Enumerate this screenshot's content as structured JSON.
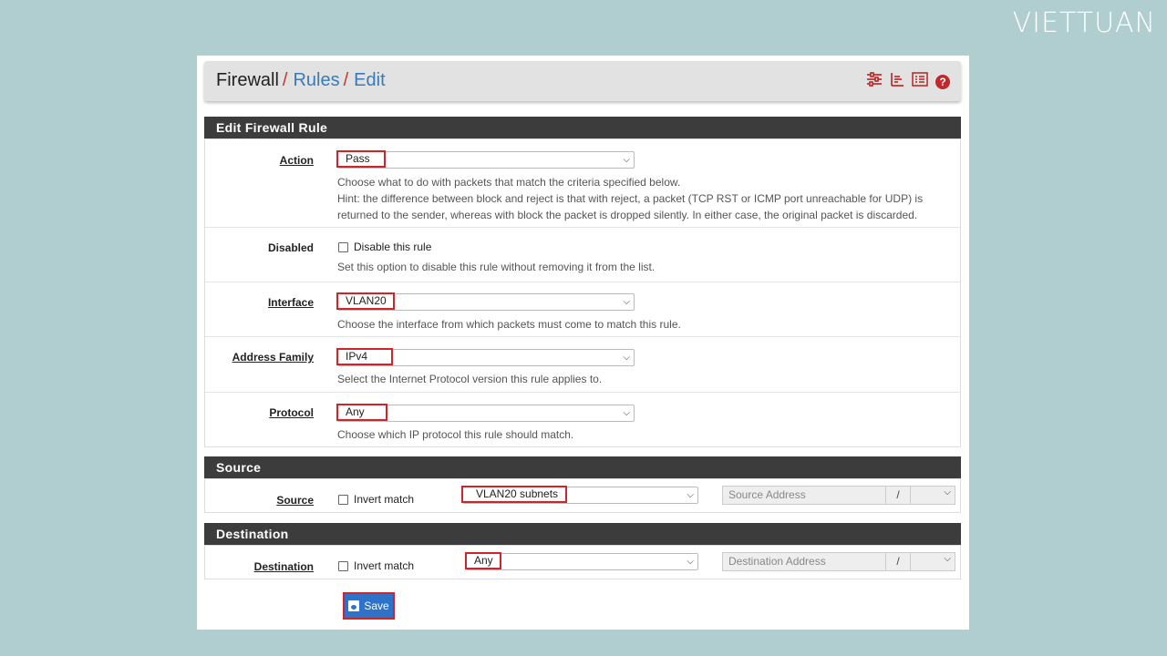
{
  "brand": {
    "logo_text": "VIETTUAN"
  },
  "breadcrumb": {
    "root": "Firewall",
    "sep": "/",
    "rules": "Rules",
    "edit": "Edit"
  },
  "header_icons": [
    "sliders-icon",
    "chart-icon",
    "list-icon",
    "help-icon"
  ],
  "edit_panel": {
    "title": "Edit Firewall Rule",
    "action": {
      "label": "Action",
      "value": "Pass",
      "help1": "Choose what to do with packets that match the criteria specified below.",
      "help2": "Hint: the difference between block and reject is that with reject, a packet (TCP RST or ICMP port unreachable for UDP) is returned to the sender, whereas with block the packet is dropped silently. In either case, the original packet is discarded."
    },
    "disabled": {
      "label": "Disabled",
      "checkbox_label": "Disable this rule",
      "checked": false,
      "help": "Set this option to disable this rule without removing it from the list."
    },
    "interface": {
      "label": "Interface",
      "value": "VLAN20",
      "help": "Choose the interface from which packets must come to match this rule."
    },
    "address_family": {
      "label": "Address Family",
      "value": "IPv4",
      "help": "Select the Internet Protocol version this rule applies to."
    },
    "protocol": {
      "label": "Protocol",
      "value": "Any",
      "help": "Choose which IP protocol this rule should match."
    }
  },
  "source_panel": {
    "title": "Source",
    "label": "Source",
    "invert_label": "Invert match",
    "invert_checked": false,
    "value": "VLAN20 subnets",
    "address_placeholder": "Source Address",
    "slash": "/"
  },
  "destination_panel": {
    "title": "Destination",
    "label": "Destination",
    "invert_label": "Invert match",
    "invert_checked": false,
    "value": "Any",
    "address_placeholder": "Destination Address",
    "slash": "/"
  },
  "save_label": "Save",
  "colors": {
    "header_dark": "#3c3c3c",
    "link": "#3a7ab8",
    "highlight": "#d0232a",
    "save": "#2f73c9",
    "background": "#b0cdcf"
  }
}
